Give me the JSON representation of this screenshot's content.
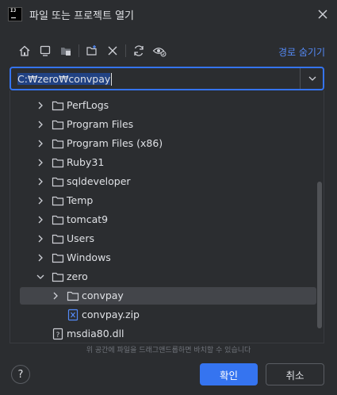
{
  "dialog": {
    "title": "파일 또는 프로젝트 열기",
    "app_icon_text": "IJ"
  },
  "toolbar": {
    "icons": [
      "home-icon",
      "desktop-icon",
      "project-icon",
      "new-folder-icon",
      "delete-icon",
      "refresh-icon",
      "show-hidden-icon"
    ],
    "hide_path_label": "경로 숨기기"
  },
  "path": {
    "selected_part": "C:₩zero₩convpay",
    "value": "C:₩zero₩convpay"
  },
  "tree": {
    "items": [
      {
        "label": "PerfLogs",
        "type": "folder",
        "level": 1,
        "expanded": false
      },
      {
        "label": "Program Files",
        "type": "folder",
        "level": 1,
        "expanded": false
      },
      {
        "label": "Program Files (x86)",
        "type": "folder",
        "level": 1,
        "expanded": false
      },
      {
        "label": "Ruby31",
        "type": "folder",
        "level": 1,
        "expanded": false
      },
      {
        "label": "sqldeveloper",
        "type": "folder",
        "level": 1,
        "expanded": false
      },
      {
        "label": "Temp",
        "type": "folder",
        "level": 1,
        "expanded": false
      },
      {
        "label": "tomcat9",
        "type": "folder",
        "level": 1,
        "expanded": false
      },
      {
        "label": "Users",
        "type": "folder",
        "level": 1,
        "expanded": false
      },
      {
        "label": "Windows",
        "type": "folder",
        "level": 1,
        "expanded": false
      },
      {
        "label": "zero",
        "type": "folder",
        "level": 1,
        "expanded": true
      },
      {
        "label": "convpay",
        "type": "folder",
        "level": 2,
        "expanded": false,
        "selected": true
      },
      {
        "label": "convpay.zip",
        "type": "zip",
        "level": 2
      },
      {
        "label": "msdia80.dll",
        "type": "file",
        "level": 1
      }
    ]
  },
  "hint": "위 공간에 파일을 드래그앤드롭하면 바치할 수 있습니다",
  "buttons": {
    "ok": "확인",
    "cancel": "취소",
    "help": "?"
  },
  "colors": {
    "background": "#2b2d30",
    "accent": "#3574f0",
    "link": "#548af7",
    "selection": "#43454a"
  }
}
